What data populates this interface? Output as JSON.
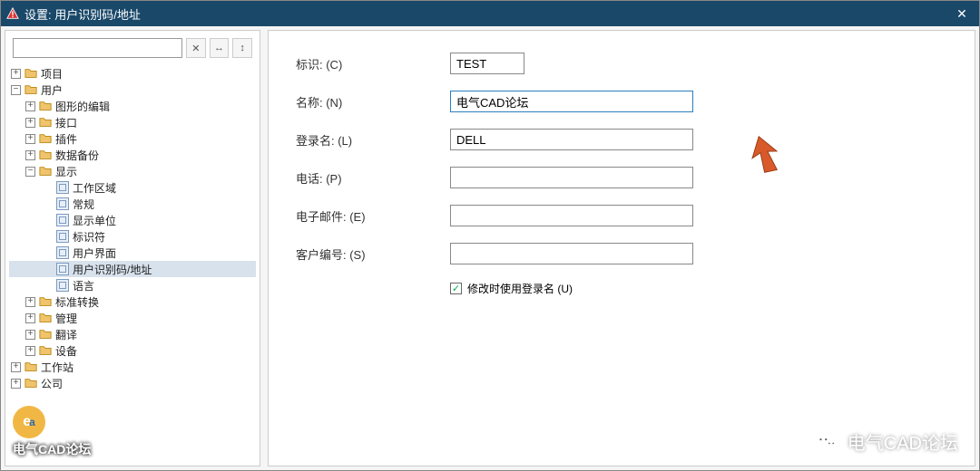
{
  "titlebar": {
    "title": "设置: 用户识别码/地址"
  },
  "toolbar": {
    "search_value": "",
    "btn_clear": "✕",
    "btn_expand": "↔",
    "btn_collapse": "↕"
  },
  "tree": {
    "project": "项目",
    "user": "用户",
    "user_graphic_edit": "图形的编辑",
    "user_interface_item": "接口",
    "user_plugins": "插件",
    "user_data_backup": "数据备份",
    "user_display": "显示",
    "disp_workarea": "工作区域",
    "disp_general": "常规",
    "disp_units": "显示单位",
    "disp_ident": "标识符",
    "disp_userui": "用户界面",
    "disp_userid_addr": "用户识别码/地址",
    "disp_language": "语言",
    "user_std_conv": "标准转换",
    "user_manage": "管理",
    "user_translate": "翻译",
    "user_device": "设备",
    "workstation": "工作站",
    "company": "公司"
  },
  "form": {
    "label_ident": "标识: (C)",
    "label_name": "名称: (N)",
    "label_login": "登录名: (L)",
    "label_phone": "电话: (P)",
    "label_email": "电子邮件: (E)",
    "label_cust": "客户编号: (S)",
    "val_ident": "TEST",
    "val_name": "电气CAD论坛",
    "val_login": "DELL",
    "val_phone": "",
    "val_email": "",
    "val_cust": "",
    "checkbox_label": "修改时使用登录名 (U)"
  },
  "watermark": {
    "left_logo": "e",
    "left_text": "电气CAD论坛",
    "right_text": "电气CAD论坛"
  }
}
